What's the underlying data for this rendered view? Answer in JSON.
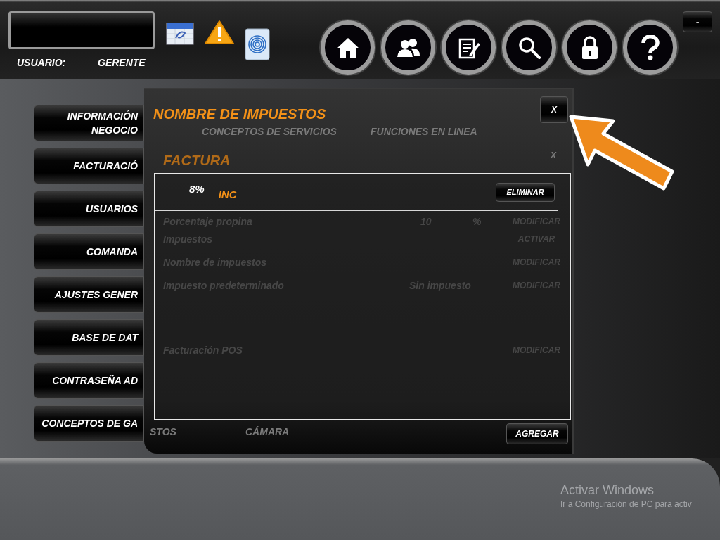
{
  "header": {
    "user_label": "USUARIO:",
    "user_value": "GERENTE",
    "minimize": "-"
  },
  "sidebar": {
    "items": [
      "INFORMACIÓN NEGOCIO",
      "FACTURACIÓ",
      "USUARIOS",
      "COMANDA",
      "AJUSTES GENER",
      "BASE DE DAT",
      "CONTRASEÑA AD",
      "CONCEPTOS DE GA"
    ]
  },
  "background_panel": {
    "tabs": [
      "CONCEPTOS DE SERVICIOS",
      "FUNCIONES EN LINEA"
    ],
    "title": "FACTURA",
    "close": "X",
    "rows": [
      {
        "label": "Porcentaje propina",
        "value": "10",
        "unit": "%",
        "action": "MODIFICAR"
      },
      {
        "label": "Impuestos",
        "action": "ACTIVAR"
      },
      {
        "label": "Nombre de impuestos",
        "action": "MODIFICAR"
      },
      {
        "label": "Impuesto predeterminado",
        "value": "Sin impuesto",
        "action": "MODIFICAR"
      },
      {
        "label": "Facturación POS",
        "action": "MODIFICAR"
      }
    ],
    "bottom_tabs": [
      "STOS",
      "CÁMARA"
    ]
  },
  "dialog": {
    "title": "NOMBRE DE IMPUESTOS",
    "close": "X",
    "taxes": [
      {
        "rate": "8%",
        "name": "INC",
        "action": "ELIMINAR"
      }
    ],
    "add_button": "AGREGAR"
  },
  "os_notice": {
    "title": "Activar Windows",
    "text": "Ir a Configuración de PC para activ"
  }
}
